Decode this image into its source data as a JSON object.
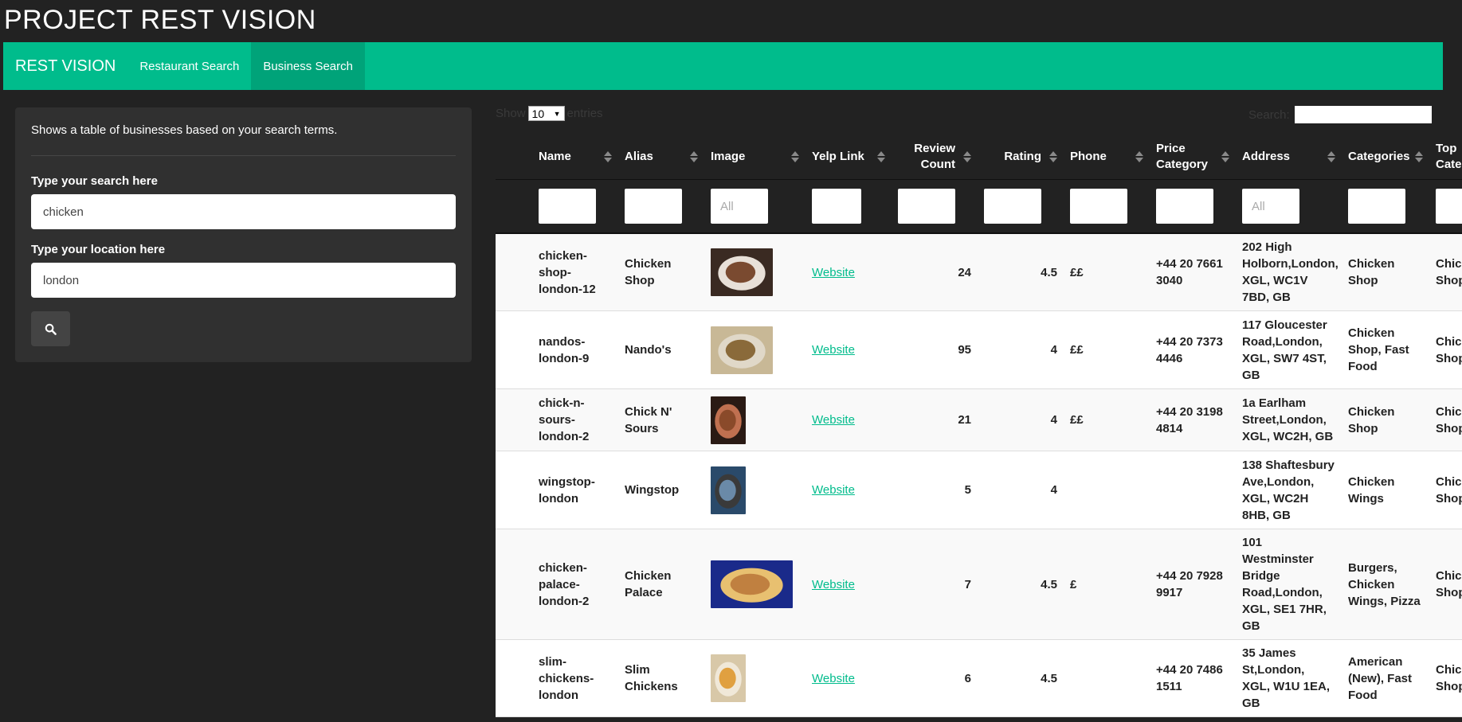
{
  "page": {
    "title": "PROJECT REST VISION"
  },
  "nav": {
    "brand": "REST VISION",
    "items": [
      {
        "label": "Restaurant Search",
        "active": false
      },
      {
        "label": "Business Search",
        "active": true
      }
    ]
  },
  "panel": {
    "description": "Shows a table of businesses based on your search terms.",
    "search_label": "Type your search here",
    "search_value": "chicken",
    "location_label": "Type your location here",
    "location_value": "london",
    "search_button_icon": "search-icon"
  },
  "table": {
    "show_label": "Show",
    "entries_label": "entries",
    "page_length": "10",
    "search_label": "Search:",
    "columns": [
      "Name",
      "Alias",
      "Image",
      "Yelp Link",
      "Review Count",
      "Rating",
      "Phone",
      "Price Category",
      "Address",
      "Categories",
      "Top Categories"
    ],
    "filter_placeholders": [
      "",
      "",
      "All",
      "",
      "",
      "",
      "",
      "",
      "All",
      "",
      ""
    ],
    "rows": [
      {
        "name": "chicken-shop-london-12",
        "alias": "Chicken Shop",
        "image": "food-photo",
        "link": "Website",
        "reviews": "24",
        "rating": "4.5",
        "price": "££",
        "phone": "+44 20 7661 3040",
        "address": "202 High Holborn,London, XGL, WC1V 7BD, GB",
        "categories": "Chicken Shop",
        "top": "Chicken Shop"
      },
      {
        "name": "nandos-london-9",
        "alias": "Nando's",
        "image": "food-photo",
        "link": "Website",
        "reviews": "95",
        "rating": "4",
        "price": "££",
        "phone": "+44 20 7373 4446",
        "address": "117 Gloucester Road,London, XGL, SW7 4ST, GB",
        "categories": "Chicken Shop, Fast Food",
        "top": "Chicken Shop"
      },
      {
        "name": "chick-n-sours-london-2",
        "alias": "Chick N' Sours",
        "image": "food-photo",
        "link": "Website",
        "reviews": "21",
        "rating": "4",
        "price": "££",
        "phone": "+44 20 3198 4814",
        "address": "1a Earlham Street,London, XGL, WC2H, GB",
        "categories": "Chicken Shop",
        "top": "Chicken Shop"
      },
      {
        "name": "wingstop-london",
        "alias": "Wingstop",
        "image": "food-photo",
        "link": "Website",
        "reviews": "5",
        "rating": "4",
        "price": "",
        "phone": "",
        "address": "138 Shaftesbury Ave,London, XGL, WC2H 8HB, GB",
        "categories": "Chicken Wings",
        "top": "Chicken Shop"
      },
      {
        "name": "chicken-palace-london-2",
        "alias": "Chicken Palace",
        "image": "food-photo",
        "link": "Website",
        "reviews": "7",
        "rating": "4.5",
        "price": "£",
        "phone": "+44 20 7928 9917",
        "address": "101 Westminster Bridge Road,London, XGL, SE1 7HR, GB",
        "categories": "Burgers, Chicken Wings, Pizza",
        "top": "Chicken Shop"
      },
      {
        "name": "slim-chickens-london",
        "alias": "Slim Chickens",
        "image": "food-photo",
        "link": "Website",
        "reviews": "6",
        "rating": "4.5",
        "price": "",
        "phone": "+44 20 7486 1511",
        "address": "35 James St,London, XGL, W1U 1EA, GB",
        "categories": "American (New), Fast Food",
        "top": "Chicken Shop"
      }
    ]
  },
  "colors": {
    "accent": "#00bc8c",
    "accent_dark": "#00a379",
    "background": "#222222",
    "panel": "#303030"
  }
}
